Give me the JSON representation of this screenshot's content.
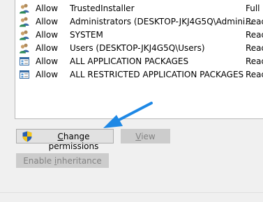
{
  "permission_entries": [
    {
      "type": "Allow",
      "principal": "TrustedInstaller",
      "access": "Full c",
      "icon": "users-icon"
    },
    {
      "type": "Allow",
      "principal": "Administrators (DESKTOP-JKJ4G5Q\\Admini...",
      "access": "Read",
      "icon": "users-icon"
    },
    {
      "type": "Allow",
      "principal": "SYSTEM",
      "access": "Read",
      "icon": "users-icon"
    },
    {
      "type": "Allow",
      "principal": "Users (DESKTOP-JKJ4G5Q\\Users)",
      "access": "Read",
      "icon": "users-icon"
    },
    {
      "type": "Allow",
      "principal": "ALL APPLICATION PACKAGES",
      "access": "Read",
      "icon": "app-package-icon"
    },
    {
      "type": "Allow",
      "principal": "ALL RESTRICTED APPLICATION PACKAGES",
      "access": "Read",
      "icon": "app-package-icon"
    }
  ],
  "buttons": {
    "change_permissions": {
      "prefix": "",
      "accel": "C",
      "rest": "hange permissions",
      "icon": "uac-shield-icon"
    },
    "view": {
      "prefix": "",
      "accel": "V",
      "rest": "iew",
      "enabled": false
    },
    "enable_inheritance": {
      "prefix": "Enable ",
      "accel": "i",
      "rest": "nheritance",
      "enabled": false
    }
  },
  "annotation": {
    "color": "#1e88e5",
    "points_to": "change-permissions-button"
  }
}
